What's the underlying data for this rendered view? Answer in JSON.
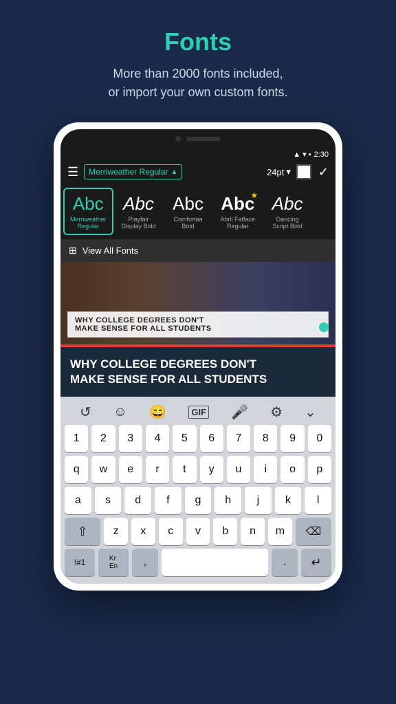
{
  "header": {
    "title": "Fonts",
    "subtitle": "More than 2000 fonts included,\nor import your own custom fonts."
  },
  "phone": {
    "status_time": "2:30"
  },
  "toolbar": {
    "font_name": "Merriweather Regular",
    "font_size": "24pt"
  },
  "fonts": [
    {
      "name": "Merriweather Regular",
      "short": "Merriweather\nRegular",
      "selected": true
    },
    {
      "name": "Playfair Display Bold",
      "short": "Playfair\nDisplay Bold",
      "selected": false
    },
    {
      "name": "Comfortaa Bold",
      "short": "Comfortaa\nBold",
      "selected": false
    },
    {
      "name": "Abril Fatface Regular",
      "short": "Abril Fatface\nRegular",
      "selected": false,
      "star": true
    },
    {
      "name": "Dancing Script Bold",
      "short": "Dancing\nScript Bold",
      "selected": false
    }
  ],
  "view_all": "View All Fonts",
  "overlay_text": "WHY COLLEGE DEGREES DON'T\nMAKE SENSE FOR ALL STUDENTS",
  "banner_text": "WHY COLLEGE DEGREES DON'T\nMAKE SENSE FOR ALL STUDENTS",
  "keyboard": {
    "row_numbers": [
      "1",
      "2",
      "3",
      "4",
      "5",
      "6",
      "7",
      "8",
      "9",
      "0"
    ],
    "row1": [
      "q",
      "w",
      "e",
      "r",
      "t",
      "y",
      "u",
      "i",
      "o",
      "p"
    ],
    "row2": [
      "a",
      "s",
      "d",
      "f",
      "g",
      "h",
      "j",
      "k",
      "l"
    ],
    "row3": [
      "z",
      "x",
      "c",
      "v",
      "b",
      "n",
      "m"
    ],
    "special_left": "!#1",
    "kr_en": "Kr/En",
    "comma": ",",
    "space": "",
    "period": ".",
    "return": "↵"
  }
}
